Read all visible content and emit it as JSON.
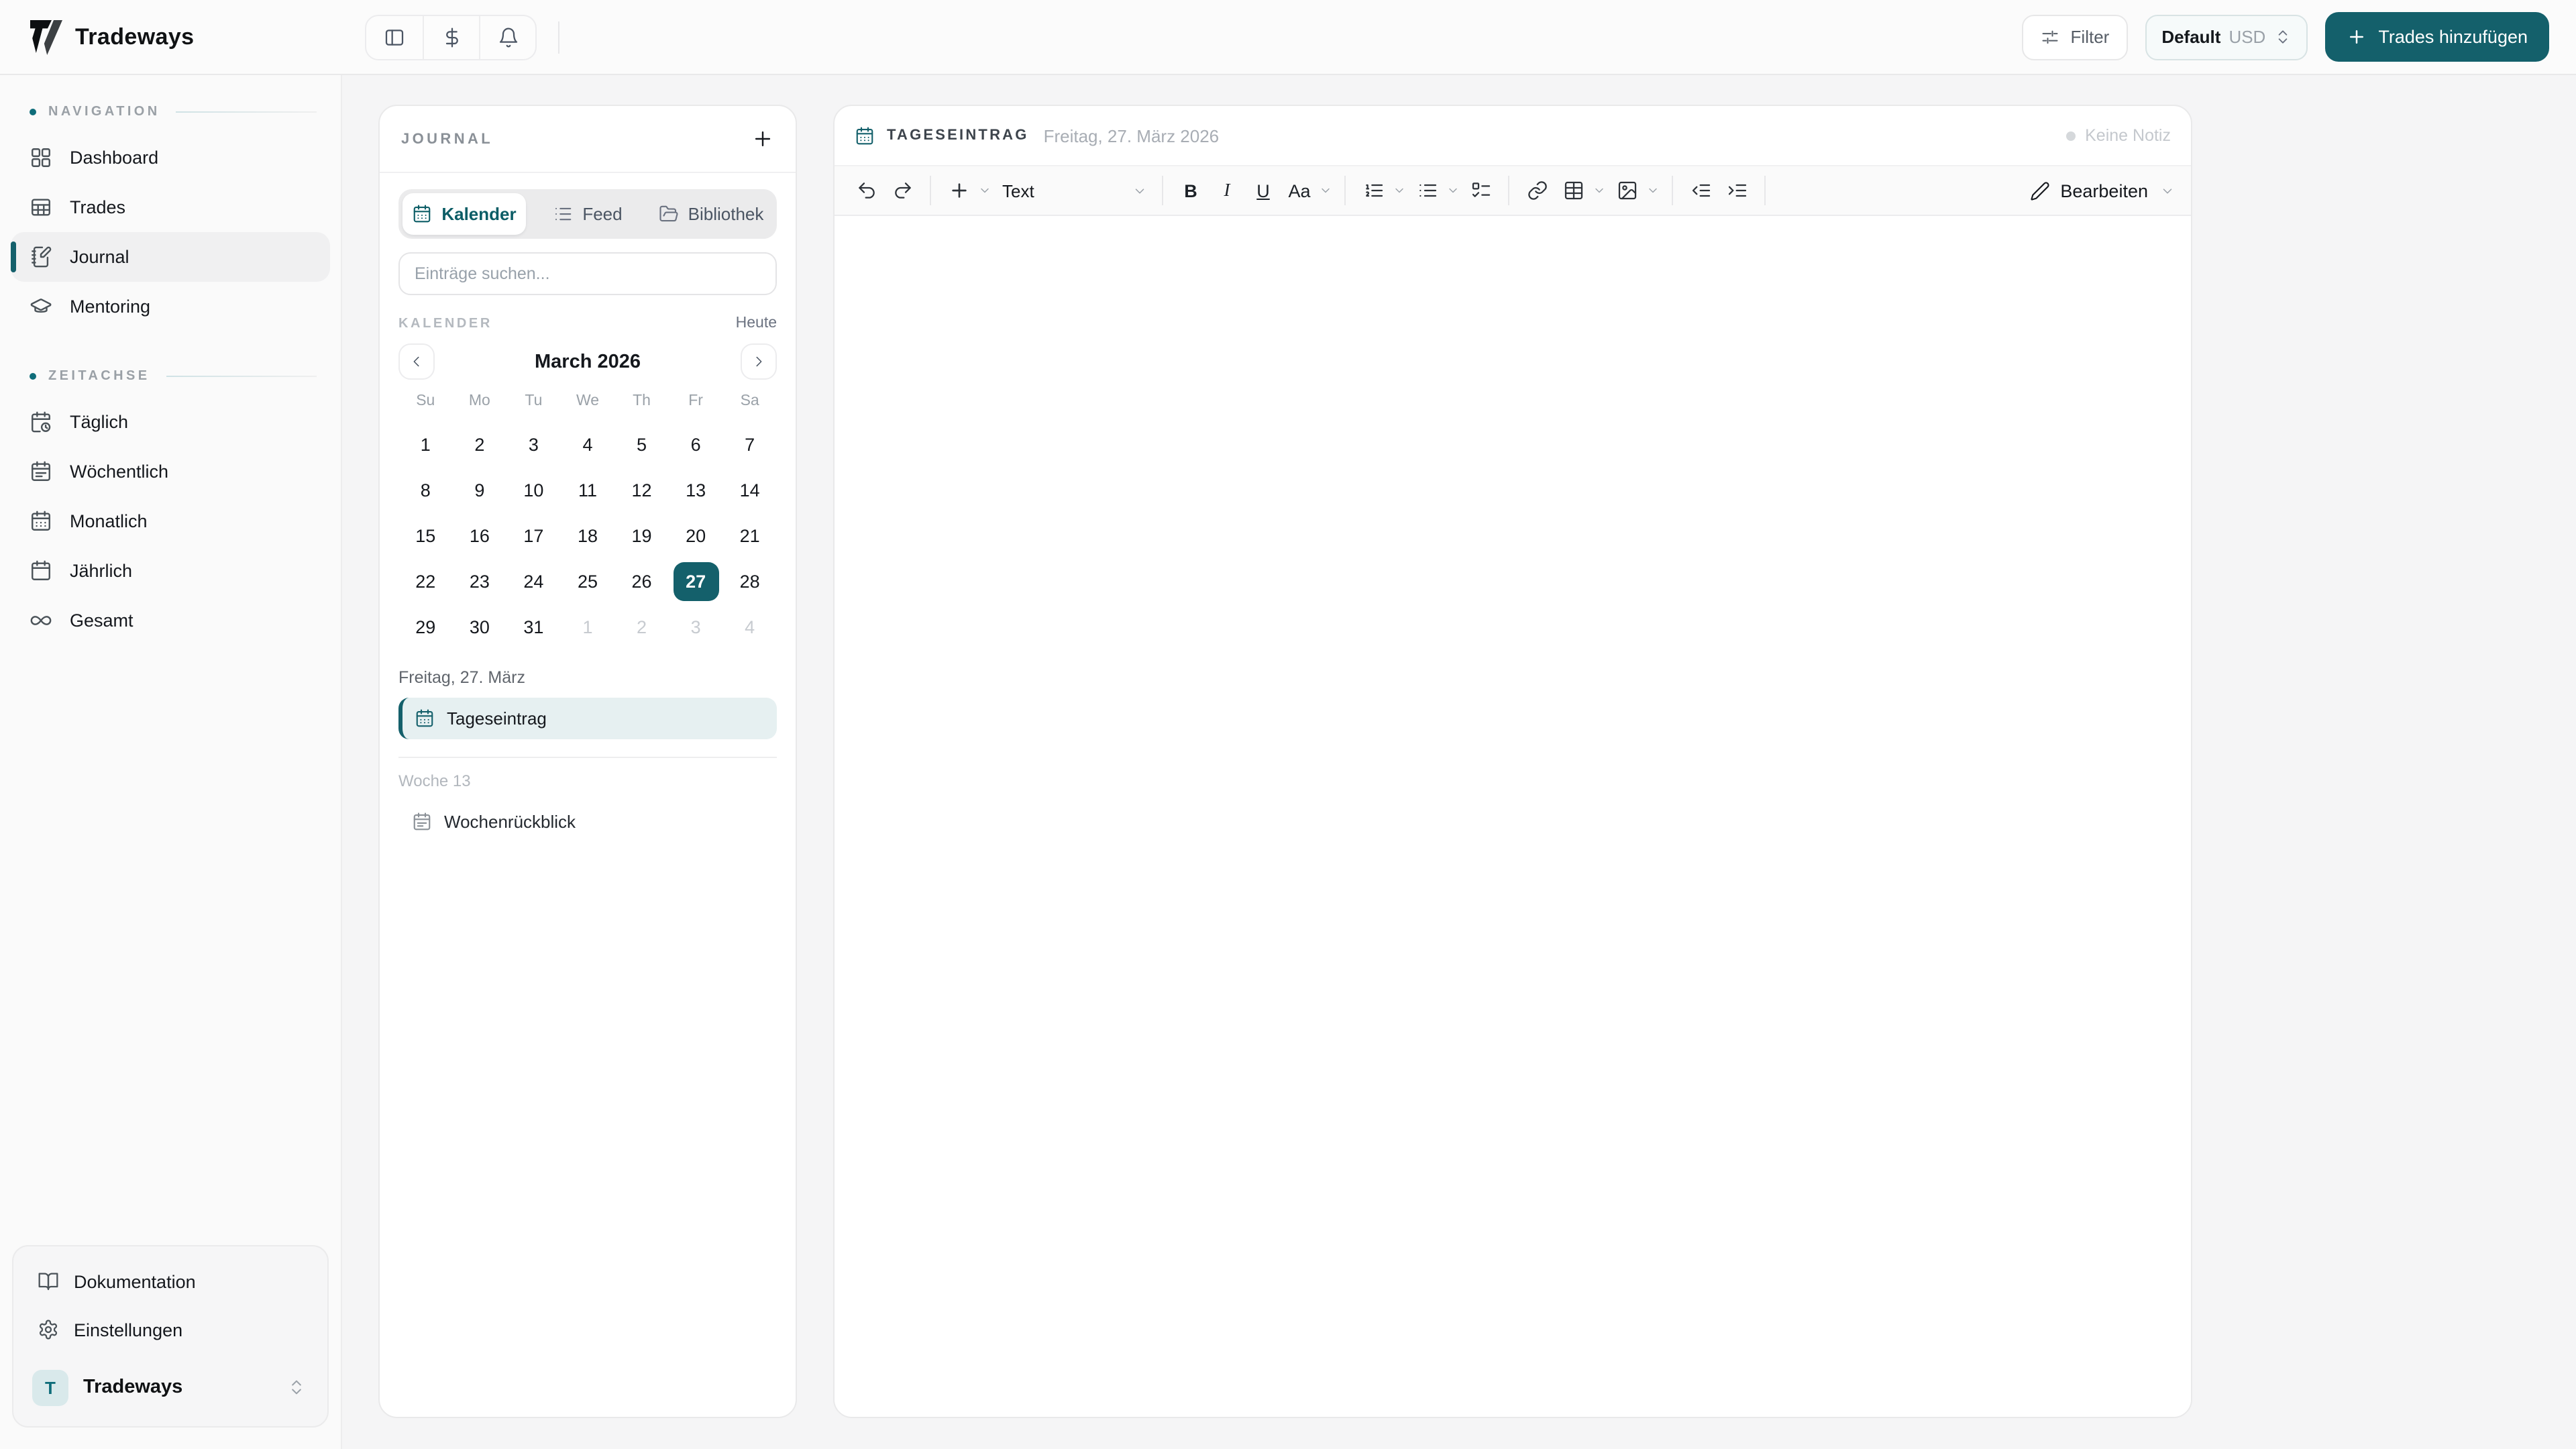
{
  "brand": {
    "name": "Tradeways"
  },
  "topbar": {
    "filter": "Filter",
    "currency_profile": "Default",
    "currency_code": "USD",
    "add_trades": "Trades hinzufügen"
  },
  "sidebar": {
    "sections": [
      {
        "label": "NAVIGATION",
        "items": [
          {
            "label": "Dashboard",
            "icon": "dashboard-icon"
          },
          {
            "label": "Trades",
            "icon": "table-icon"
          },
          {
            "label": "Journal",
            "icon": "notebook-pen-icon",
            "active": true
          },
          {
            "label": "Mentoring",
            "icon": "graduation-cap-icon"
          }
        ]
      },
      {
        "label": "ZEITACHSE",
        "items": [
          {
            "label": "Täglich",
            "icon": "calendar-clock-icon"
          },
          {
            "label": "Wöchentlich",
            "icon": "calendar-lines-icon"
          },
          {
            "label": "Monatlich",
            "icon": "calendar-grid-icon"
          },
          {
            "label": "Jährlich",
            "icon": "calendar-icon"
          },
          {
            "label": "Gesamt",
            "icon": "infinity-icon"
          }
        ]
      }
    ],
    "footer": {
      "docs": "Dokumentation",
      "settings": "Einstellungen",
      "workspace_initial": "T",
      "workspace_name": "Tradeways"
    }
  },
  "journal": {
    "title": "JOURNAL",
    "tabs": [
      {
        "label": "Kalender",
        "icon": "calendar-grid-icon"
      },
      {
        "label": "Feed",
        "icon": "list-icon"
      },
      {
        "label": "Bibliothek",
        "icon": "folder-icon"
      }
    ],
    "active_tab": "Kalender",
    "search_placeholder": "Einträge suchen...",
    "calendar": {
      "label": "KALENDER",
      "today": "Heute",
      "month": "March 2026",
      "weekdays": [
        "Su",
        "Mo",
        "Tu",
        "We",
        "Th",
        "Fr",
        "Sa"
      ],
      "weeks": [
        [
          "1",
          "2",
          "3",
          "4",
          "5",
          "6",
          "7"
        ],
        [
          "8",
          "9",
          "10",
          "11",
          "12",
          "13",
          "14"
        ],
        [
          "15",
          "16",
          "17",
          "18",
          "19",
          "20",
          "21"
        ],
        [
          "22",
          "23",
          "24",
          "25",
          "26",
          "27",
          "28"
        ],
        [
          "29",
          "30",
          "31",
          "1*",
          "2*",
          "3*",
          "4*"
        ]
      ],
      "selected_day": "27"
    },
    "entries": {
      "day_group": "Freitag, 27. März",
      "day_entry": "Tageseintrag",
      "week_group": "Woche 13",
      "week_entry": "Wochenrückblick"
    }
  },
  "editor": {
    "type": "TAGESEINTRAG",
    "date": "Freitag, 27. März 2026",
    "note_status": "Keine Notiz",
    "toolbar": {
      "format": "Text",
      "bold": "B",
      "italic": "I",
      "underline": "U",
      "text_style": "Aa",
      "mode": "Bearbeiten"
    }
  },
  "colors": {
    "accent": "#14606b",
    "accent_soft": "#e6f0f1",
    "page_bg": "#f5f5f6",
    "card_bg": "#ffffff"
  }
}
